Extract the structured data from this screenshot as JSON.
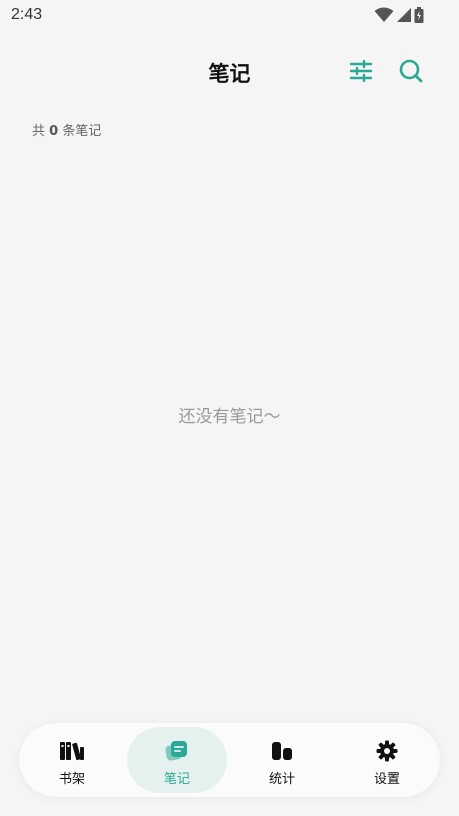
{
  "status_bar": {
    "time": "2:43"
  },
  "header": {
    "title": "笔记",
    "filter_icon": "sliders-icon",
    "search_icon": "search-icon"
  },
  "summary": {
    "prefix": "共",
    "count": "0",
    "suffix": "条笔记"
  },
  "empty_state": {
    "text": "还没有笔记～"
  },
  "bottom_nav": {
    "active_index": 1,
    "items": [
      {
        "label": "书架",
        "icon": "books-icon"
      },
      {
        "label": "笔记",
        "icon": "notes-icon"
      },
      {
        "label": "统计",
        "icon": "stats-icon"
      },
      {
        "label": "设置",
        "icon": "settings-gear-icon"
      }
    ]
  },
  "colors": {
    "accent": "#2ba896",
    "background": "#f5f5f5",
    "active_nav_bg": "#e4f1ee",
    "muted_text": "#999999"
  }
}
